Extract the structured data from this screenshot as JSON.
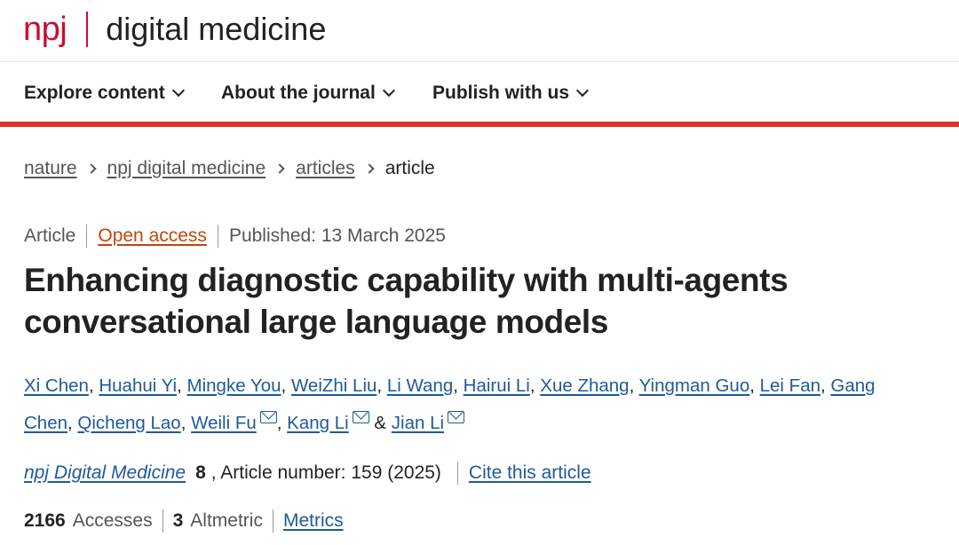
{
  "brand": {
    "logo_mark": "npj",
    "journal_name": "digital medicine",
    "accent_color": "#c8102e"
  },
  "nav": {
    "items": [
      {
        "label": "Explore content",
        "icon": "chevron-down-icon"
      },
      {
        "label": "About the journal",
        "icon": "chevron-down-icon"
      },
      {
        "label": "Publish with us",
        "icon": "chevron-down-icon"
      }
    ],
    "underline_color": "#e0312c"
  },
  "breadcrumb": {
    "links": [
      "nature",
      "npj digital medicine",
      "articles"
    ],
    "current": "article"
  },
  "article": {
    "type": "Article",
    "access": "Open access",
    "published": "Published: 13 March 2025",
    "title_line1": "Enhancing diagnostic capability with multi-agents",
    "title_line2": "conversational large language models",
    "authors": [
      "Xi Chen",
      "Huahui Yi",
      "Mingke You",
      "WeiZhi Liu",
      "Li Wang",
      "Hairui Li",
      "Xue Zhang",
      "Yingman Guo",
      "Lei Fan",
      "Gang",
      "Chen",
      "Qicheng Lao",
      "Weili Fu",
      "Kang Li",
      "Jian Li"
    ],
    "author_connector": "&",
    "corresponding_icon": "mail-icon",
    "link_color": "#1e5a9c"
  },
  "citation": {
    "journal": "npj Digital Medicine",
    "volume": "8",
    "article_number": ", Article number: 159 (2025)",
    "cite_label": "Cite this article"
  },
  "metrics": {
    "accesses_count": "2166",
    "accesses_label": "Accesses",
    "altmetric_count": "3",
    "altmetric_label": "Altmetric",
    "metrics_link": "Metrics"
  }
}
